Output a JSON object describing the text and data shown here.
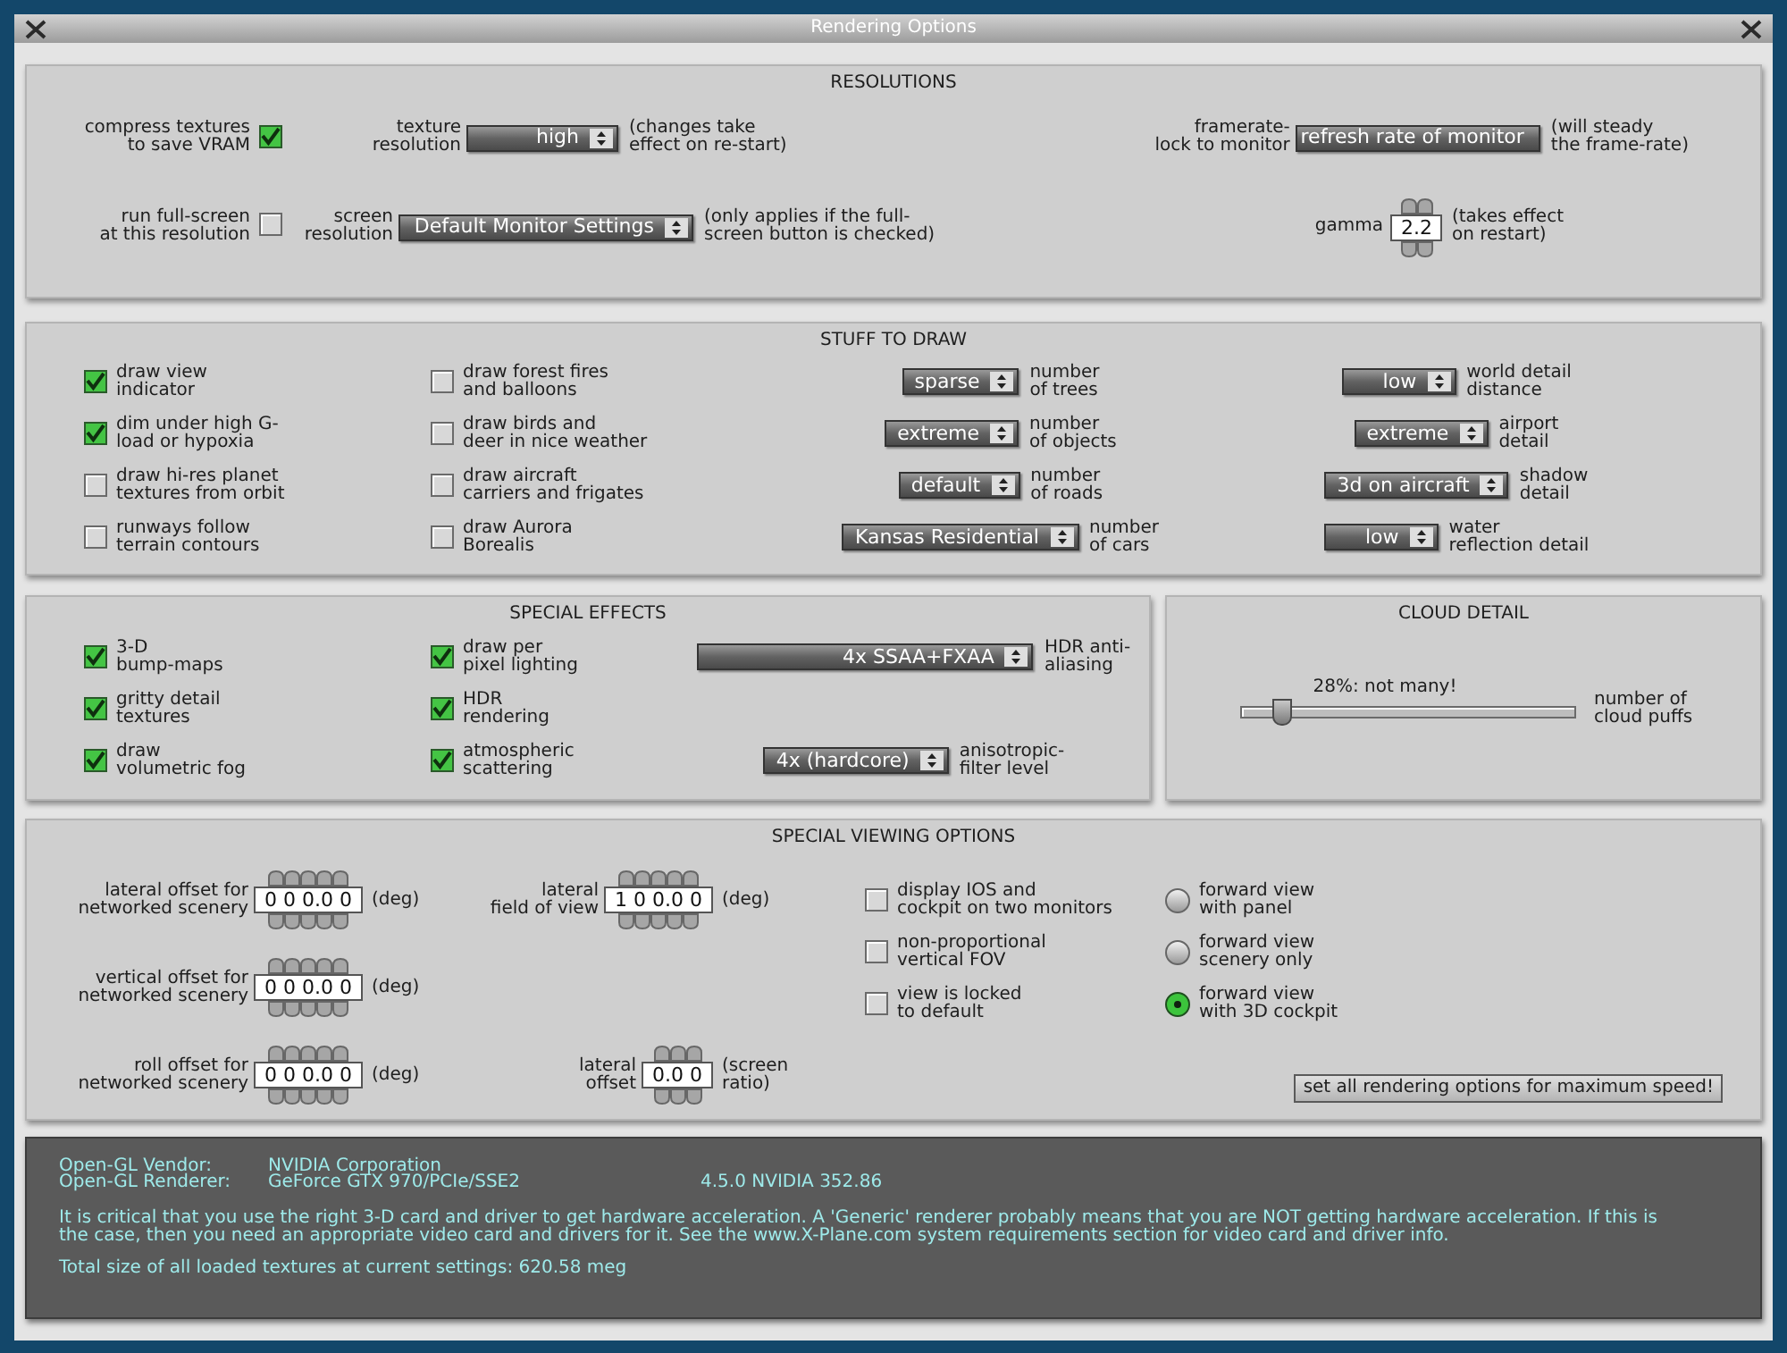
{
  "window": {
    "title": "Rendering Options"
  },
  "resolutions": {
    "title": "RESOLUTIONS",
    "compress_textures": {
      "label": "compress textures\nto save VRAM",
      "checked": true
    },
    "texture_resolution": {
      "label": "texture\nresolution",
      "value": "high",
      "note": "(changes take\neffect on re-start)"
    },
    "framerate_lock": {
      "label": "framerate-\nlock to monitor",
      "value": "refresh rate of monitor",
      "note": "(will steady\nthe frame-rate)"
    },
    "run_full_screen": {
      "label": "run full-screen\nat this resolution",
      "checked": false
    },
    "screen_resolution": {
      "label": "screen\nresolution",
      "value": "Default Monitor Settings",
      "note": "(only applies if the full-\nscreen button is checked)"
    },
    "gamma": {
      "label": "gamma",
      "value": "2.2",
      "note": "(takes effect\non restart)"
    }
  },
  "stuff_to_draw": {
    "title": "STUFF TO DRAW",
    "rows": [
      [
        {
          "kind": "checkbox",
          "label": "draw view\nindicator",
          "checked": true
        },
        {
          "kind": "checkbox",
          "label": "draw forest fires\nand balloons",
          "checked": false
        },
        {
          "kind": "dropdown",
          "value": "sparse",
          "label": "number\nof trees"
        },
        {
          "kind": "dropdown",
          "value": "low",
          "label": "world detail\ndistance"
        }
      ],
      [
        {
          "kind": "checkbox",
          "label": "dim under high G-\nload or hypoxia",
          "checked": true
        },
        {
          "kind": "checkbox",
          "label": "draw birds and\ndeer in nice weather",
          "checked": false
        },
        {
          "kind": "dropdown",
          "value": "extreme",
          "label": "number\nof objects"
        },
        {
          "kind": "dropdown",
          "value": "extreme",
          "label": "airport\ndetail"
        }
      ],
      [
        {
          "kind": "checkbox",
          "label": "draw hi-res planet\ntextures from orbit",
          "checked": false
        },
        {
          "kind": "checkbox",
          "label": "draw aircraft\ncarriers and frigates",
          "checked": false
        },
        {
          "kind": "dropdown",
          "value": "default",
          "label": "number\nof roads"
        },
        {
          "kind": "dropdown",
          "value": "3d on aircraft",
          "label": "shadow\ndetail"
        }
      ],
      [
        {
          "kind": "checkbox",
          "label": "runways follow\nterrain contours",
          "checked": false
        },
        {
          "kind": "checkbox",
          "label": "draw Aurora\nBorealis",
          "checked": false
        },
        {
          "kind": "dropdown",
          "value": "Kansas Residential",
          "label": "number\nof cars"
        },
        {
          "kind": "dropdown",
          "value": "low",
          "label": "water\nreflection detail"
        }
      ]
    ]
  },
  "special_effects": {
    "title": "SPECIAL EFFECTS",
    "rows": [
      [
        {
          "kind": "checkbox",
          "label": "3-D\nbump-maps",
          "checked": true
        },
        {
          "kind": "checkbox",
          "label": "draw per\npixel lighting",
          "checked": true
        },
        {
          "kind": "dropdown",
          "value": "4x SSAA+FXAA",
          "label": "HDR anti-\naliasing"
        }
      ],
      [
        {
          "kind": "checkbox",
          "label": "gritty detail\ntextures",
          "checked": true
        },
        {
          "kind": "checkbox",
          "label": "HDR\nrendering",
          "checked": true
        }
      ],
      [
        {
          "kind": "checkbox",
          "label": "draw\nvolumetric fog",
          "checked": true
        },
        {
          "kind": "checkbox",
          "label": "atmospheric\nscattering",
          "checked": true
        },
        {
          "kind": "dropdown",
          "value": "4x (hardcore)",
          "label": "anisotropic-\nfilter level"
        }
      ]
    ]
  },
  "cloud_detail": {
    "title": "CLOUD DETAIL",
    "reading": "28%: not many!",
    "level": 0.12,
    "label": "number of\ncloud puffs"
  },
  "special_viewing": {
    "title": "SPECIAL VIEWING OPTIONS",
    "offsets": [
      {
        "label": "lateral offset for\nnetworked scenery",
        "value": "0 0 0.0 0",
        "unit": "(deg)"
      },
      {
        "label": "vertical offset for\nnetworked scenery",
        "value": "0 0 0.0 0",
        "unit": "(deg)"
      },
      {
        "label": "roll offset for\nnetworked scenery",
        "value": "0 0 0.0 0",
        "unit": "(deg)"
      }
    ],
    "view": [
      {
        "label": "lateral\nfield of view",
        "value": "1 0 0.0 0",
        "unit": "(deg)"
      },
      {
        "label": "lateral\noffset",
        "value": "0.0 0",
        "unit": "(screen\nratio)"
      }
    ],
    "checkboxes": [
      {
        "label": "display IOS and\ncockpit on two monitors",
        "checked": false
      },
      {
        "label": "non-proportional\nvertical FOV",
        "checked": false
      },
      {
        "label": "view is locked\nto default",
        "checked": false
      }
    ],
    "radios": [
      {
        "label": "forward view\nwith panel",
        "selected": false
      },
      {
        "label": "forward view\nscenery only",
        "selected": false
      },
      {
        "label": "forward view\nwith 3D cockpit",
        "selected": true
      }
    ],
    "button": "set all rendering options for maximum speed!"
  },
  "info": {
    "vendor_label": "Open-GL Vendor:",
    "vendor": "NVIDIA Corporation",
    "renderer_label": "Open-GL Renderer:",
    "renderer": "GeForce GTX 970/PCIe/SSE2",
    "version": "4.5.0 NVIDIA 352.86",
    "notice": "It is critical that you use the right 3-D card and driver to get hardware acceleration. A 'Generic' renderer probably means that you are NOT getting hardware acceleration. If this is the case, then you need an appropriate video card and drivers for it. See the www.X-Plane.com system requirements section for video card and driver info.",
    "total": "Total size of all loaded textures at current settings: 620.58 meg"
  }
}
